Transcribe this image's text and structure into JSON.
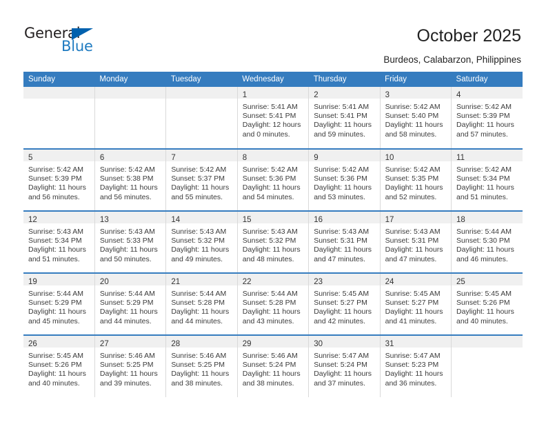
{
  "brand": {
    "name_top": "General",
    "name_bottom": "Blue",
    "color_dark": "#231f20",
    "color_blue": "#1f7bc1",
    "triangle_color": "#0061ae"
  },
  "header": {
    "title": "October 2025",
    "subtitle": "Burdeos, Calabarzon, Philippines"
  },
  "theme": {
    "header_bar": "#357cbf",
    "row_divider": "#357cbf",
    "daynum_band": "#f0f0f0",
    "cell_border": "#d9d9d9"
  },
  "weekday_headers": [
    "Sunday",
    "Monday",
    "Tuesday",
    "Wednesday",
    "Thursday",
    "Friday",
    "Saturday"
  ],
  "labels": {
    "sunrise_prefix": "Sunrise:",
    "sunset_prefix": "Sunset:",
    "daylight_prefix": "Daylight:"
  },
  "weeks": [
    [
      {
        "day": "",
        "empty": true
      },
      {
        "day": "",
        "empty": true
      },
      {
        "day": "",
        "empty": true
      },
      {
        "day": "1",
        "sunrise": "Sunrise: 5:41 AM",
        "sunset": "Sunset: 5:41 PM",
        "daylight_1": "Daylight: 12 hours",
        "daylight_2": "and 0 minutes."
      },
      {
        "day": "2",
        "sunrise": "Sunrise: 5:41 AM",
        "sunset": "Sunset: 5:41 PM",
        "daylight_1": "Daylight: 11 hours",
        "daylight_2": "and 59 minutes."
      },
      {
        "day": "3",
        "sunrise": "Sunrise: 5:42 AM",
        "sunset": "Sunset: 5:40 PM",
        "daylight_1": "Daylight: 11 hours",
        "daylight_2": "and 58 minutes."
      },
      {
        "day": "4",
        "sunrise": "Sunrise: 5:42 AM",
        "sunset": "Sunset: 5:39 PM",
        "daylight_1": "Daylight: 11 hours",
        "daylight_2": "and 57 minutes."
      }
    ],
    [
      {
        "day": "5",
        "sunrise": "Sunrise: 5:42 AM",
        "sunset": "Sunset: 5:39 PM",
        "daylight_1": "Daylight: 11 hours",
        "daylight_2": "and 56 minutes."
      },
      {
        "day": "6",
        "sunrise": "Sunrise: 5:42 AM",
        "sunset": "Sunset: 5:38 PM",
        "daylight_1": "Daylight: 11 hours",
        "daylight_2": "and 56 minutes."
      },
      {
        "day": "7",
        "sunrise": "Sunrise: 5:42 AM",
        "sunset": "Sunset: 5:37 PM",
        "daylight_1": "Daylight: 11 hours",
        "daylight_2": "and 55 minutes."
      },
      {
        "day": "8",
        "sunrise": "Sunrise: 5:42 AM",
        "sunset": "Sunset: 5:36 PM",
        "daylight_1": "Daylight: 11 hours",
        "daylight_2": "and 54 minutes."
      },
      {
        "day": "9",
        "sunrise": "Sunrise: 5:42 AM",
        "sunset": "Sunset: 5:36 PM",
        "daylight_1": "Daylight: 11 hours",
        "daylight_2": "and 53 minutes."
      },
      {
        "day": "10",
        "sunrise": "Sunrise: 5:42 AM",
        "sunset": "Sunset: 5:35 PM",
        "daylight_1": "Daylight: 11 hours",
        "daylight_2": "and 52 minutes."
      },
      {
        "day": "11",
        "sunrise": "Sunrise: 5:42 AM",
        "sunset": "Sunset: 5:34 PM",
        "daylight_1": "Daylight: 11 hours",
        "daylight_2": "and 51 minutes."
      }
    ],
    [
      {
        "day": "12",
        "sunrise": "Sunrise: 5:43 AM",
        "sunset": "Sunset: 5:34 PM",
        "daylight_1": "Daylight: 11 hours",
        "daylight_2": "and 51 minutes."
      },
      {
        "day": "13",
        "sunrise": "Sunrise: 5:43 AM",
        "sunset": "Sunset: 5:33 PM",
        "daylight_1": "Daylight: 11 hours",
        "daylight_2": "and 50 minutes."
      },
      {
        "day": "14",
        "sunrise": "Sunrise: 5:43 AM",
        "sunset": "Sunset: 5:32 PM",
        "daylight_1": "Daylight: 11 hours",
        "daylight_2": "and 49 minutes."
      },
      {
        "day": "15",
        "sunrise": "Sunrise: 5:43 AM",
        "sunset": "Sunset: 5:32 PM",
        "daylight_1": "Daylight: 11 hours",
        "daylight_2": "and 48 minutes."
      },
      {
        "day": "16",
        "sunrise": "Sunrise: 5:43 AM",
        "sunset": "Sunset: 5:31 PM",
        "daylight_1": "Daylight: 11 hours",
        "daylight_2": "and 47 minutes."
      },
      {
        "day": "17",
        "sunrise": "Sunrise: 5:43 AM",
        "sunset": "Sunset: 5:31 PM",
        "daylight_1": "Daylight: 11 hours",
        "daylight_2": "and 47 minutes."
      },
      {
        "day": "18",
        "sunrise": "Sunrise: 5:44 AM",
        "sunset": "Sunset: 5:30 PM",
        "daylight_1": "Daylight: 11 hours",
        "daylight_2": "and 46 minutes."
      }
    ],
    [
      {
        "day": "19",
        "sunrise": "Sunrise: 5:44 AM",
        "sunset": "Sunset: 5:29 PM",
        "daylight_1": "Daylight: 11 hours",
        "daylight_2": "and 45 minutes."
      },
      {
        "day": "20",
        "sunrise": "Sunrise: 5:44 AM",
        "sunset": "Sunset: 5:29 PM",
        "daylight_1": "Daylight: 11 hours",
        "daylight_2": "and 44 minutes."
      },
      {
        "day": "21",
        "sunrise": "Sunrise: 5:44 AM",
        "sunset": "Sunset: 5:28 PM",
        "daylight_1": "Daylight: 11 hours",
        "daylight_2": "and 44 minutes."
      },
      {
        "day": "22",
        "sunrise": "Sunrise: 5:44 AM",
        "sunset": "Sunset: 5:28 PM",
        "daylight_1": "Daylight: 11 hours",
        "daylight_2": "and 43 minutes."
      },
      {
        "day": "23",
        "sunrise": "Sunrise: 5:45 AM",
        "sunset": "Sunset: 5:27 PM",
        "daylight_1": "Daylight: 11 hours",
        "daylight_2": "and 42 minutes."
      },
      {
        "day": "24",
        "sunrise": "Sunrise: 5:45 AM",
        "sunset": "Sunset: 5:27 PM",
        "daylight_1": "Daylight: 11 hours",
        "daylight_2": "and 41 minutes."
      },
      {
        "day": "25",
        "sunrise": "Sunrise: 5:45 AM",
        "sunset": "Sunset: 5:26 PM",
        "daylight_1": "Daylight: 11 hours",
        "daylight_2": "and 40 minutes."
      }
    ],
    [
      {
        "day": "26",
        "sunrise": "Sunrise: 5:45 AM",
        "sunset": "Sunset: 5:26 PM",
        "daylight_1": "Daylight: 11 hours",
        "daylight_2": "and 40 minutes."
      },
      {
        "day": "27",
        "sunrise": "Sunrise: 5:46 AM",
        "sunset": "Sunset: 5:25 PM",
        "daylight_1": "Daylight: 11 hours",
        "daylight_2": "and 39 minutes."
      },
      {
        "day": "28",
        "sunrise": "Sunrise: 5:46 AM",
        "sunset": "Sunset: 5:25 PM",
        "daylight_1": "Daylight: 11 hours",
        "daylight_2": "and 38 minutes."
      },
      {
        "day": "29",
        "sunrise": "Sunrise: 5:46 AM",
        "sunset": "Sunset: 5:24 PM",
        "daylight_1": "Daylight: 11 hours",
        "daylight_2": "and 38 minutes."
      },
      {
        "day": "30",
        "sunrise": "Sunrise: 5:47 AM",
        "sunset": "Sunset: 5:24 PM",
        "daylight_1": "Daylight: 11 hours",
        "daylight_2": "and 37 minutes."
      },
      {
        "day": "31",
        "sunrise": "Sunrise: 5:47 AM",
        "sunset": "Sunset: 5:23 PM",
        "daylight_1": "Daylight: 11 hours",
        "daylight_2": "and 36 minutes."
      },
      {
        "day": "",
        "empty": true
      }
    ]
  ]
}
